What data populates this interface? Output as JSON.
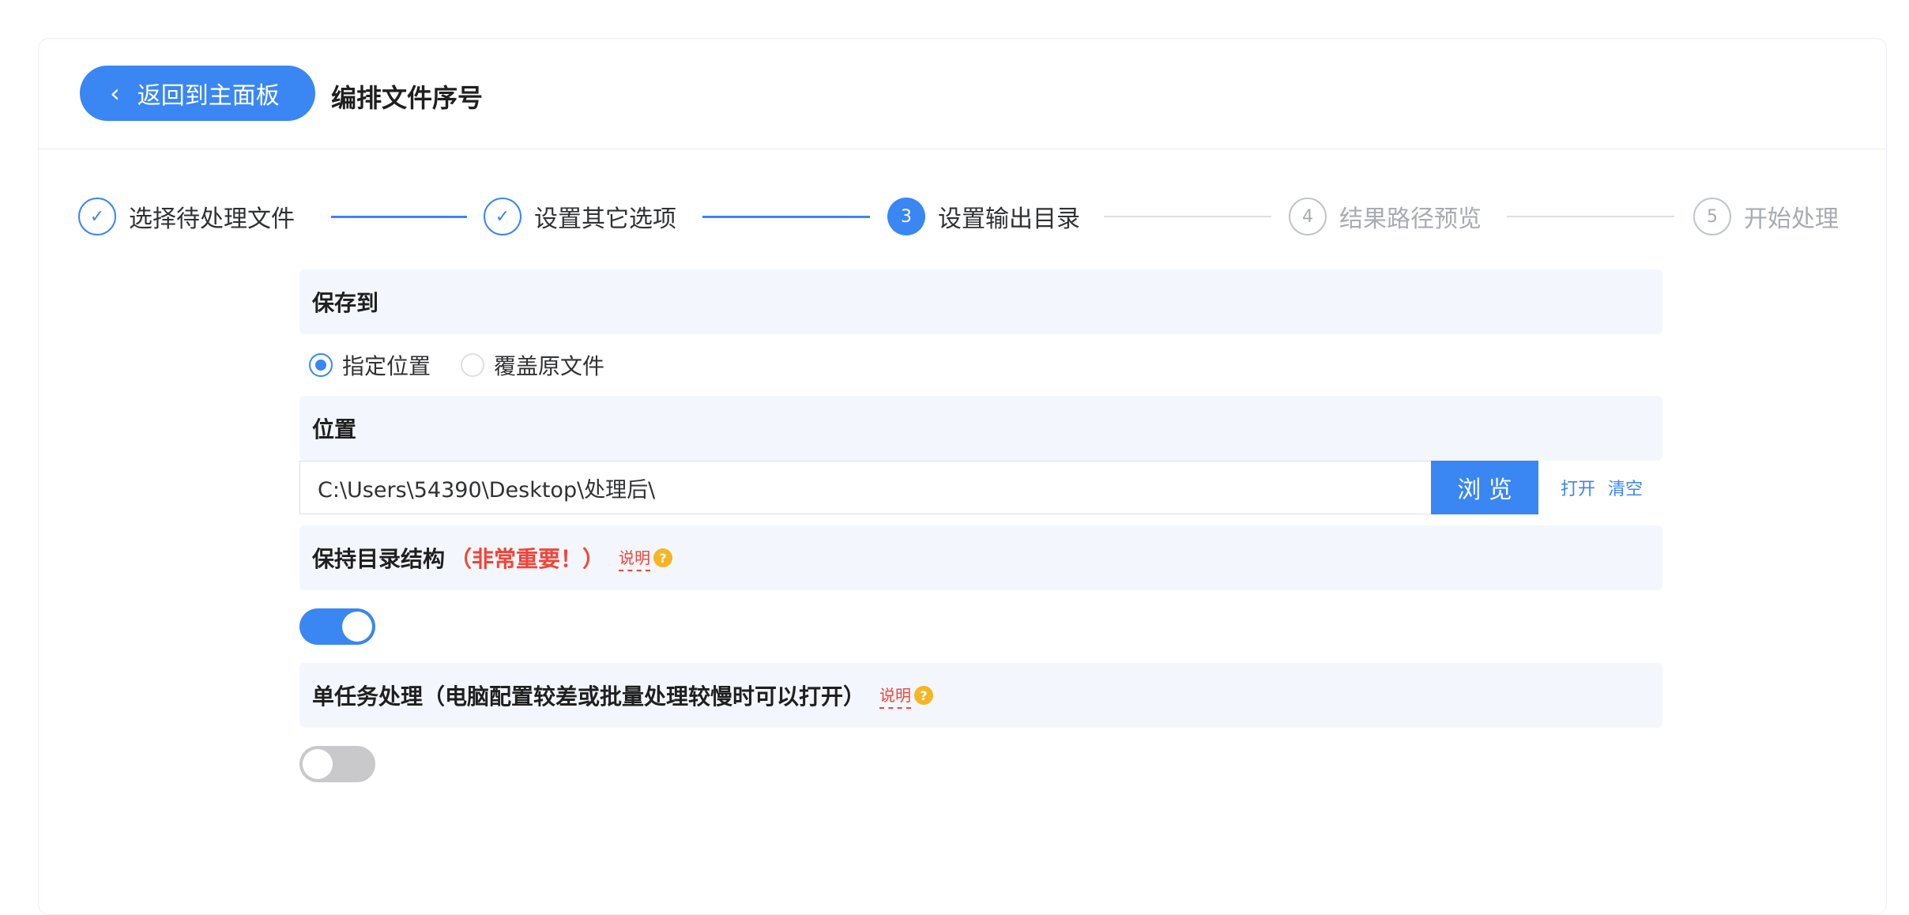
{
  "header": {
    "back_label": "返回到主面板",
    "title": "编排文件序号"
  },
  "steps": [
    {
      "number": "1",
      "label": "选择待处理文件",
      "state": "done"
    },
    {
      "number": "2",
      "label": "设置其它选项",
      "state": "done"
    },
    {
      "number": "3",
      "label": "设置输出目录",
      "state": "active"
    },
    {
      "number": "4",
      "label": "结果路径预览",
      "state": "todo"
    },
    {
      "number": "5",
      "label": "开始处理",
      "state": "todo"
    }
  ],
  "save_to": {
    "title": "保存到",
    "options": [
      {
        "label": "指定位置",
        "checked": true
      },
      {
        "label": "覆盖原文件",
        "checked": false
      }
    ]
  },
  "location": {
    "title": "位置",
    "path": "C:\\Users\\54390\\Desktop\\处理后\\",
    "browse_label": "浏 览",
    "open_label": "打开",
    "clear_label": "清空"
  },
  "keep_structure": {
    "title": "保持目录结构",
    "important": "（非常重要！）",
    "help": "说明",
    "enabled": true
  },
  "single_task": {
    "title": "单任务处理（电脑配置较差或批量处理较慢时可以打开）",
    "help": "说明",
    "enabled": false
  },
  "colors": {
    "primary": "#3a86f2",
    "danger": "#f44336",
    "help_icon": "#f5b524"
  }
}
